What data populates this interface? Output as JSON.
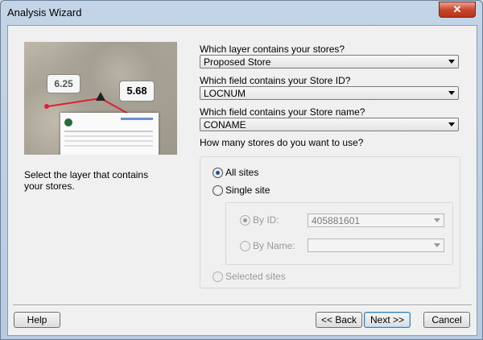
{
  "window": {
    "title": "Analysis Wizard",
    "close_glyph": "✕"
  },
  "illustration": {
    "bubble_left": "6.25",
    "bubble_right": "5.68"
  },
  "left_description": "Select the layer that contains your stores.",
  "fields": {
    "layer": {
      "label": "Which layer contains your stores?",
      "value": "Proposed Store"
    },
    "store_id": {
      "label": "Which field contains your Store ID?",
      "value": "LOCNUM"
    },
    "store_name": {
      "label": "Which field contains your Store name?",
      "value": "CONAME"
    }
  },
  "stores_question": "How many stores do you want to use?",
  "options": {
    "all_sites": "All sites",
    "single_site": "Single site",
    "by_id": "By ID:",
    "by_id_value": "405881601",
    "by_name": "By Name:",
    "selected_sites": "Selected sites"
  },
  "buttons": {
    "help": "Help",
    "back": "<< Back",
    "next": "Next >>",
    "cancel": "Cancel"
  },
  "colors": {
    "accent": "#3c7fb1",
    "close": "#c9462c"
  }
}
